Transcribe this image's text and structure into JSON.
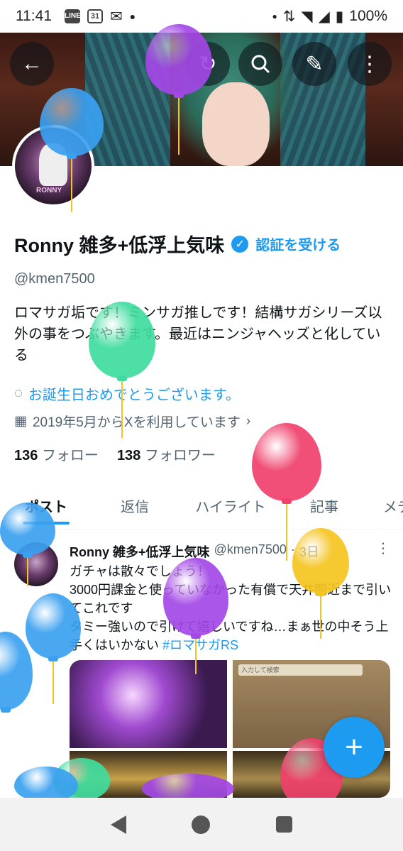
{
  "status_bar": {
    "time": "11:41",
    "line_badge": "LINE",
    "calendar_badge": "31",
    "battery": "100%",
    "icons": [
      "line-icon",
      "calendar-icon",
      "mail-icon",
      "dot-icon",
      "signal-icon",
      "wifi-icon",
      "battery-icon"
    ]
  },
  "banner": {
    "buttons": [
      "back-icon",
      "refresh-icon",
      "search-icon",
      "edit-icon",
      "more-icon"
    ]
  },
  "profile": {
    "avatar_caption": "RONNY",
    "name": "Ronny 雑多+低浮上気味",
    "verified_badge": "✓",
    "get_verified": "認証を受ける",
    "handle": "@kmen7500",
    "bio": "ロマサガ垢です！ミンサガ推しです！結構サガシリーズ以外の事をつぶやきます。最近はニンジャヘッズと化している",
    "birthday": "お誕生日おめでとうございます。",
    "joined": "2019年5月からXを利用しています",
    "following_count": "136",
    "following_label": "フォロー",
    "followers_count": "138",
    "followers_label": "フォロワー"
  },
  "tabs": [
    {
      "label": "ポスト"
    },
    {
      "label": "返信"
    },
    {
      "label": "ハイライト"
    },
    {
      "label": "記事"
    },
    {
      "label": "メデ"
    }
  ],
  "tweet": {
    "author": "Ronny 雑多+低浮上気味",
    "handle": "@kmen7500",
    "time": "3日",
    "line1": "ガチャは散々でしょう！",
    "line2": "3000円課金と使っていなかった有償で天井間近まで引いてこれです",
    "line3": "タミー強いので引けて嬉しいですね…まぁ世の中そう上手くはいかない",
    "hashtag": "#ロマサガRS",
    "media_search": "入力して検索"
  },
  "fab_label": "+",
  "colors": {
    "accent": "#1d9bf0",
    "balloon_blue": "#3aa0f0",
    "balloon_purple": "#a347e6",
    "balloon_green": "#3fdc9e",
    "balloon_red": "#f0406c",
    "balloon_yellow": "#f5c41f"
  }
}
